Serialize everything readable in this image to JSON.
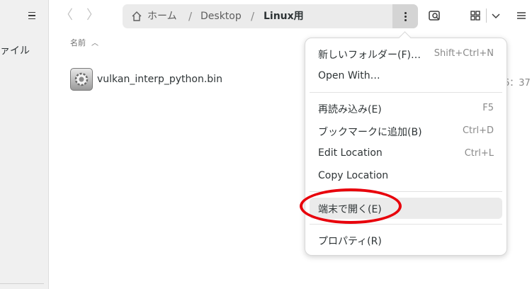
{
  "sidebar": {
    "partial_label": "ァイル"
  },
  "header": {
    "path": [
      "ホーム",
      "Desktop",
      "Linux用"
    ],
    "separators": [
      "/",
      "/"
    ]
  },
  "content": {
    "column_header": "名前",
    "files": [
      {
        "name": "vulkan_interp_python.bin",
        "time_partial": "6：37"
      }
    ]
  },
  "menu": {
    "items": [
      {
        "label": "新しいフォルダー(F)…",
        "accel": "Shift+Ctrl+N"
      },
      {
        "label": "Open With…",
        "accel": ""
      },
      {
        "label": "再読み込み(E)",
        "accel": "F5"
      },
      {
        "label": "ブックマークに追加(B)",
        "accel": "Ctrl+D"
      },
      {
        "label": "Edit Location",
        "accel": "Ctrl+L"
      },
      {
        "label": "Copy Location",
        "accel": ""
      },
      {
        "label": "端末で開く(E)",
        "accel": ""
      },
      {
        "label": "プロパティ(R)",
        "accel": ""
      }
    ]
  },
  "colors": {
    "highlight_ring": "#e8000b",
    "hover_item": "#ebebeb"
  }
}
